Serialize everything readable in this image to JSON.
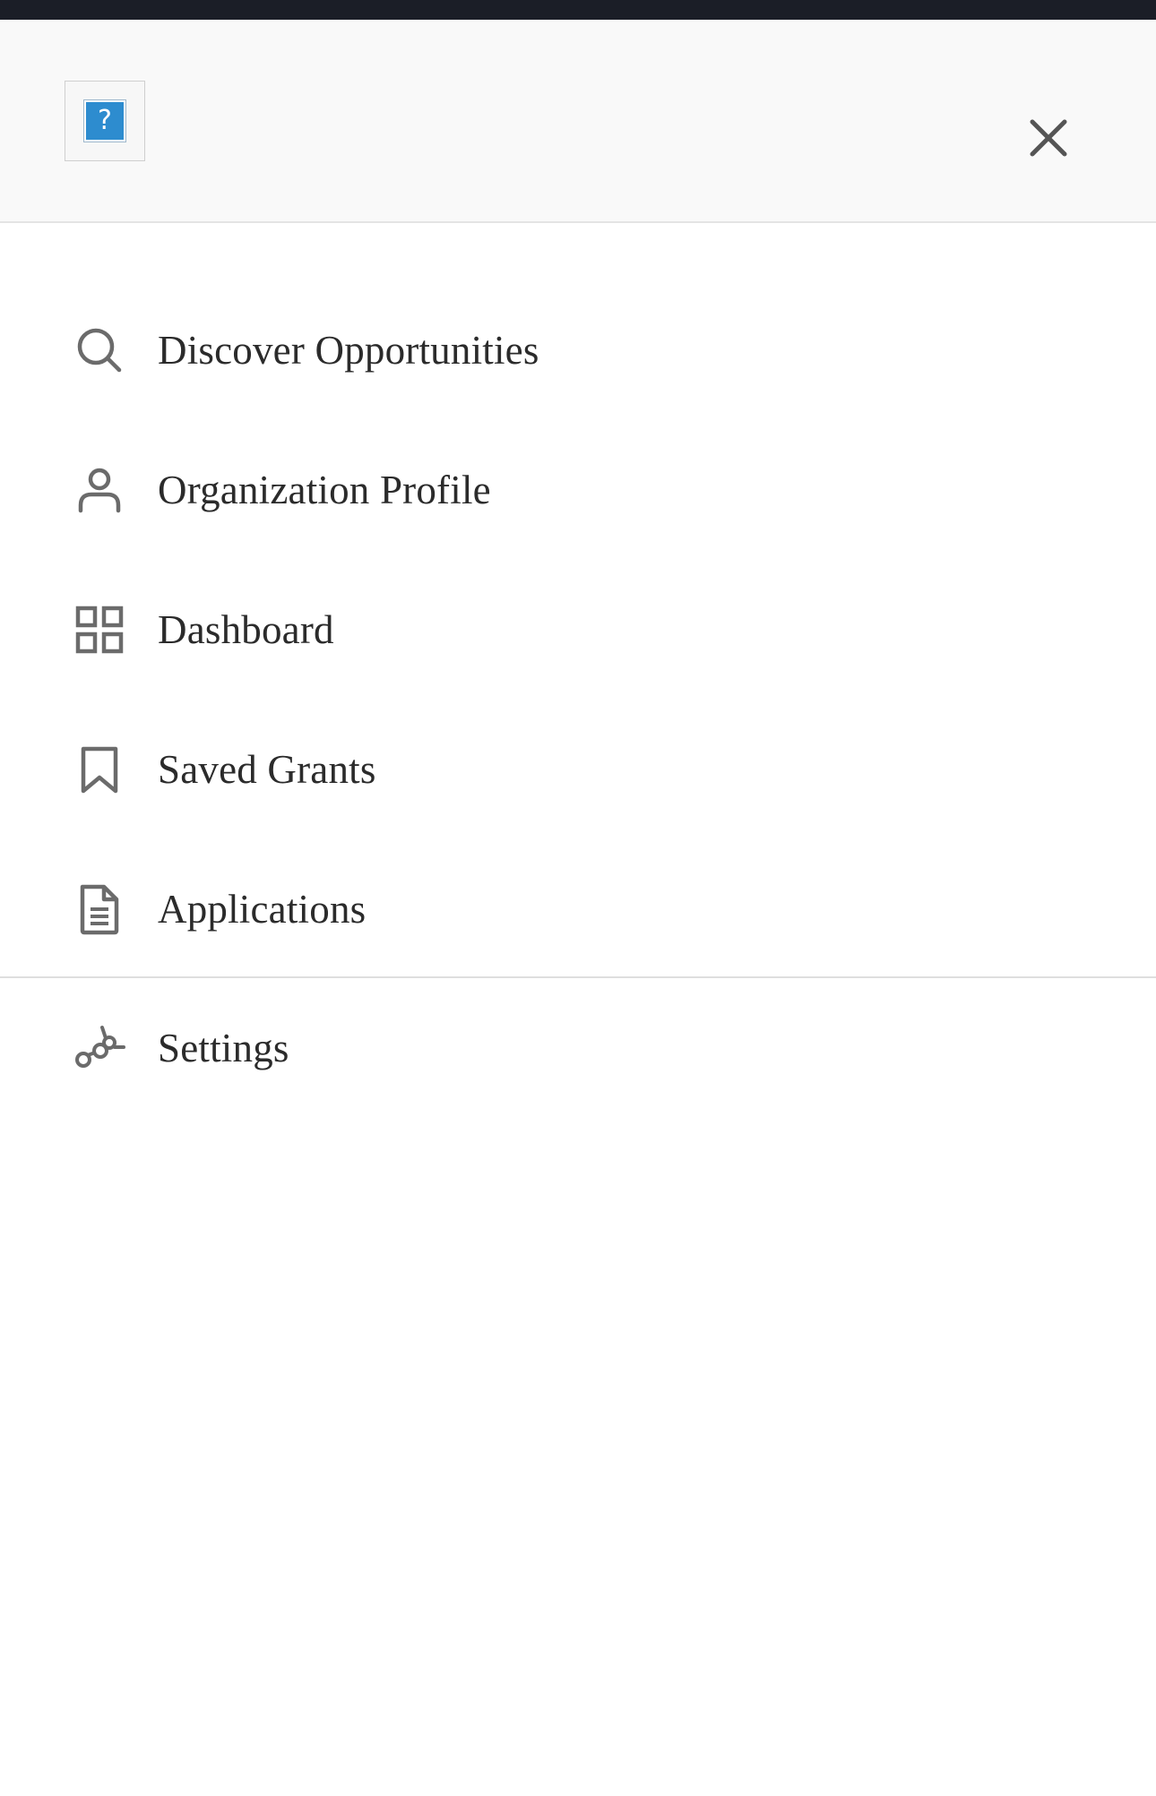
{
  "header": {
    "logo_glyph": "?",
    "close_icon": "close-icon"
  },
  "menu": {
    "items": [
      {
        "label": "Discover Opportunities",
        "icon": "search-icon"
      },
      {
        "label": "Organization Profile",
        "icon": "user-icon"
      },
      {
        "label": "Dashboard",
        "icon": "grid-icon"
      },
      {
        "label": "Saved Grants",
        "icon": "bookmark-icon"
      },
      {
        "label": "Applications",
        "icon": "document-icon"
      }
    ],
    "settings": {
      "label": "Settings",
      "icon": "settings-icon"
    }
  },
  "colors": {
    "top_bar": "#1b1e27",
    "header_bg": "#f9f9f9",
    "icon": "#6b6b6b",
    "text": "#2b2b2b",
    "logo_blue": "#2d8ccf"
  }
}
